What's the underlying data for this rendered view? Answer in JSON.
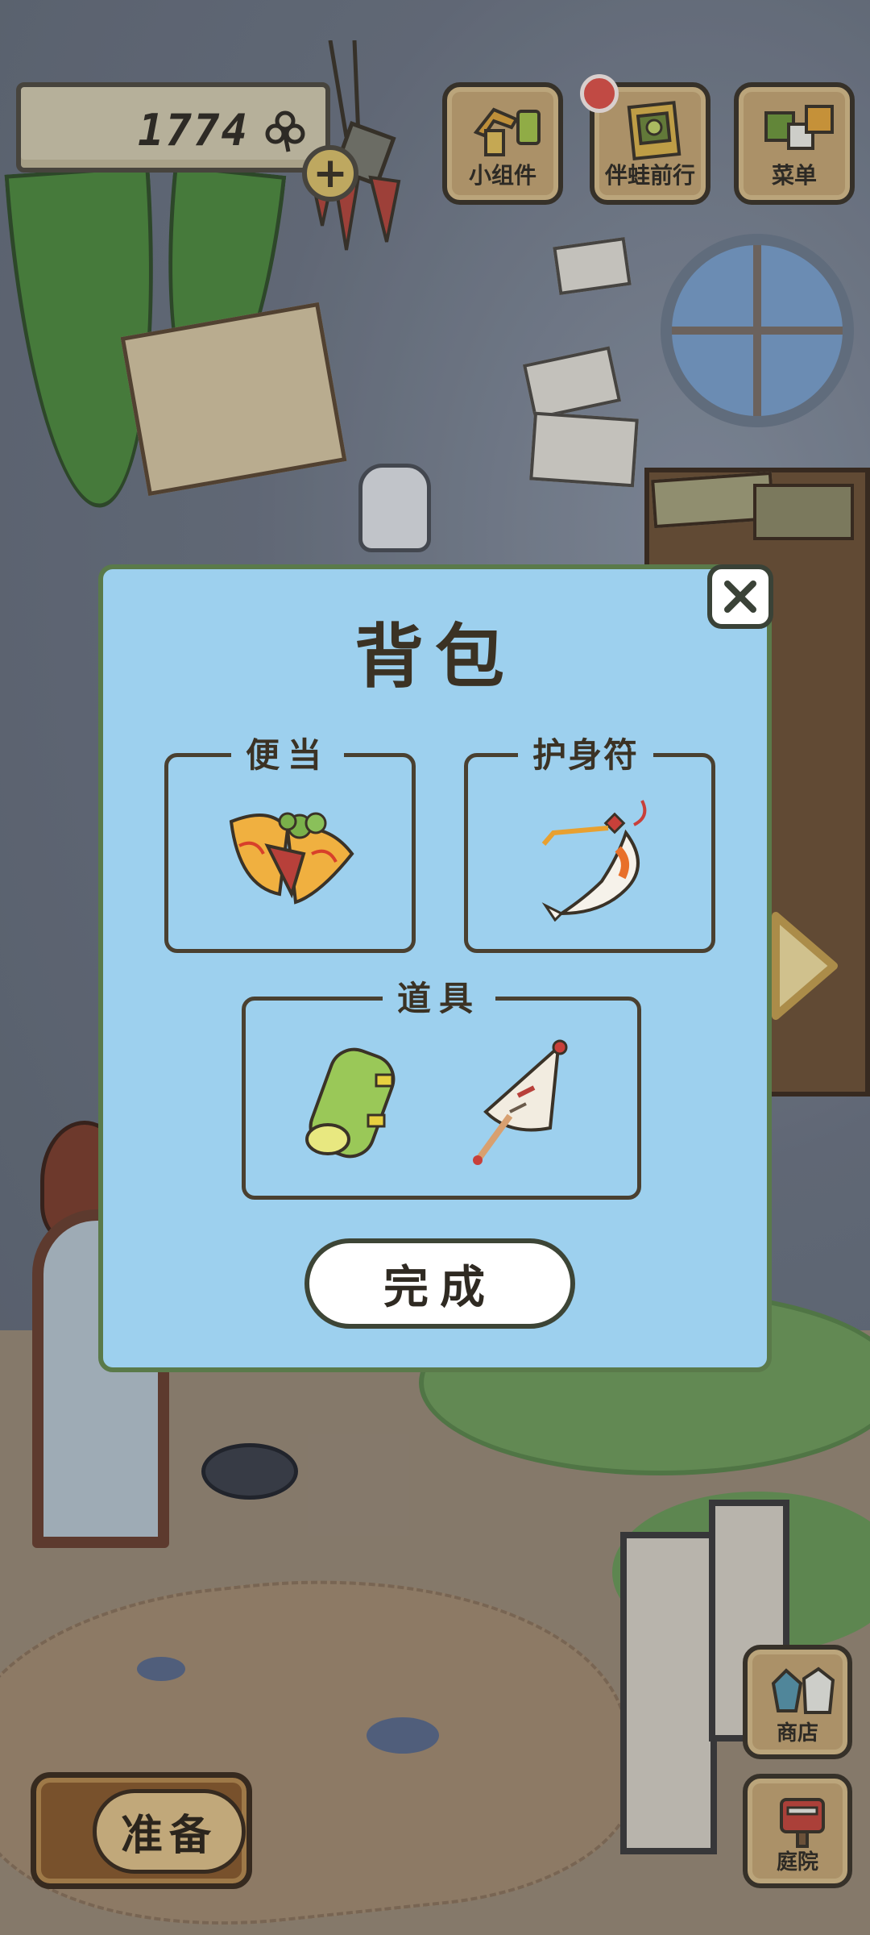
{
  "hud": {
    "currency_value": "1774",
    "currency_icon": "clover-icon",
    "add_currency_symbol": "+",
    "buttons": {
      "widgets_label": "小组件",
      "companion_label": "伴蛙前行",
      "menu_label": "菜单"
    },
    "notification_color": "#e35147"
  },
  "backpack": {
    "title": "背包",
    "close_symbol": "✕",
    "sections": {
      "bento_label": "便当",
      "charm_label": "护身符",
      "tools_label": "道具"
    },
    "items": {
      "bento": "dumpling-bento-icon",
      "charm": "koi-charm-icon",
      "tool_1": "green-mat-roll-icon",
      "tool_2": "paper-umbrella-icon"
    },
    "done_label": "完成"
  },
  "bottom": {
    "prepare_label": "准备",
    "shop_label": "商店",
    "yard_label": "庭院"
  },
  "colors": {
    "modal_bg": "#9dd0ee",
    "wood": "#c8a873",
    "text_dark": "#3b3224"
  }
}
